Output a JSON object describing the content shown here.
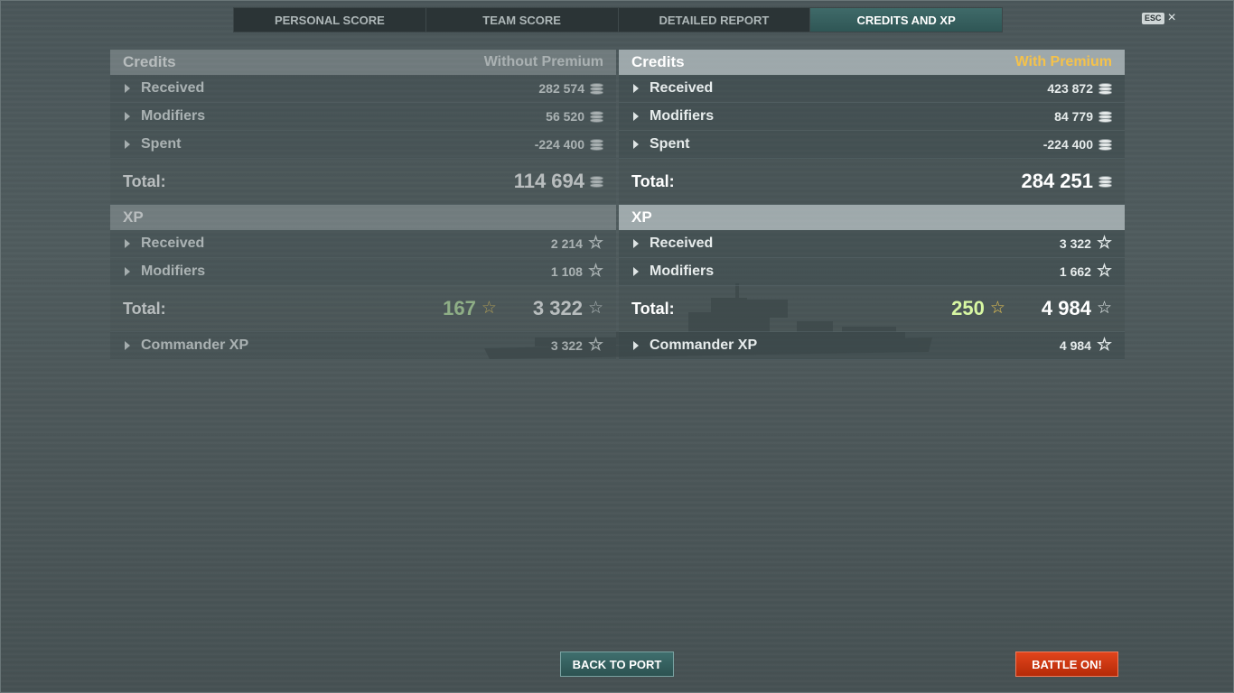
{
  "tabs": [
    "PERSONAL SCORE",
    "TEAM SCORE",
    "DETAILED REPORT",
    "CREDITS AND XP"
  ],
  "esc": {
    "key": "ESC",
    "close": "×"
  },
  "left": {
    "credits_title": "Credits",
    "mode": "Without Premium",
    "credits_rows": [
      {
        "label": "Received",
        "value": "282 574"
      },
      {
        "label": "Modifiers",
        "value": "56 520"
      },
      {
        "label": "Spent",
        "value": "-224 400"
      }
    ],
    "credits_total_label": "Total:",
    "credits_total": "114 694",
    "xp_title": "XP",
    "xp_rows": [
      {
        "label": "Received",
        "value": "2 214"
      },
      {
        "label": "Modifiers",
        "value": "1 108"
      }
    ],
    "xp_total_label": "Total:",
    "xp_bonus": "167",
    "xp_total": "3 322",
    "commander_label": "Commander XP",
    "commander_value": "3 322"
  },
  "right": {
    "credits_title": "Credits",
    "mode": "With Premium",
    "credits_rows": [
      {
        "label": "Received",
        "value": "423 872"
      },
      {
        "label": "Modifiers",
        "value": "84 779"
      },
      {
        "label": "Spent",
        "value": "-224 400"
      }
    ],
    "credits_total_label": "Total:",
    "credits_total": "284 251",
    "xp_title": "XP",
    "xp_rows": [
      {
        "label": "Received",
        "value": "3 322"
      },
      {
        "label": "Modifiers",
        "value": "1 662"
      }
    ],
    "xp_total_label": "Total:",
    "xp_bonus": "250",
    "xp_total": "4 984",
    "commander_label": "Commander XP",
    "commander_value": "4 984"
  },
  "buttons": {
    "back": "BACK TO PORT",
    "battle": "BATTLE ON!"
  },
  "colors": {
    "premium": "#f5c24a",
    "battle": "#d23a12",
    "active_tab": "#3f6a69"
  }
}
